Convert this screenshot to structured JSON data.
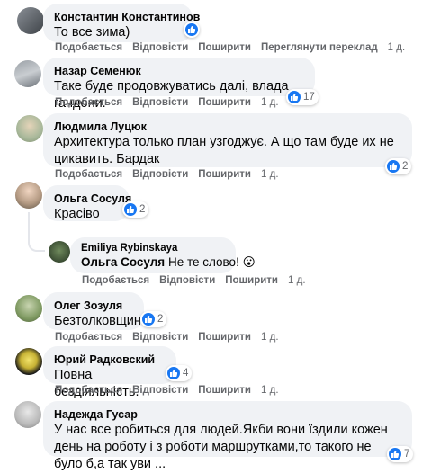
{
  "actions": {
    "like": "Подобається",
    "reply": "Відповісти",
    "share": "Поширити",
    "translate": "Переглянути переклад"
  },
  "colors": {
    "like": "#1877f2",
    "bubble": "#f0f2f5",
    "meta": "#65676b"
  },
  "comments": [
    {
      "author": "Константин Константинов",
      "text": "То все зима)",
      "time": "1 д.",
      "reactions": ""
    },
    {
      "author": "Назар Семенюк",
      "text": "Таке буде продовжуватись далі, влада гандони.",
      "time": "1 д.",
      "reactions": "17"
    },
    {
      "author": "Людмила Луцюк",
      "text": "Архитектура только план узгоджує. А що там буде их не цикавить. Бардак",
      "time": "1 д.",
      "reactions": "2"
    },
    {
      "author": "Ольга Сосуля",
      "text": "Красіво",
      "time": "",
      "reactions": "2"
    },
    {
      "author": "Emiliya Rybinskaya",
      "tag": "Ольга Сосуля",
      "text": " Не те слово! ",
      "emoji": "😮",
      "time": "1 д.",
      "reactions": ""
    },
    {
      "author": "Олег Зозуля",
      "text": "Безтолковщина",
      "time": "1 д.",
      "reactions": "2"
    },
    {
      "author": "Юрий Радковский",
      "text": "Повна бездіяльність.",
      "time": "1 д.",
      "reactions": "4"
    },
    {
      "author": "Надежда Гусар",
      "text": "У нас все робиться для людей.Якби вони їздили кожен день на роботу і з роботи маршрутками,то такого не було б,а так уви ...",
      "time": "",
      "reactions": "7"
    }
  ]
}
